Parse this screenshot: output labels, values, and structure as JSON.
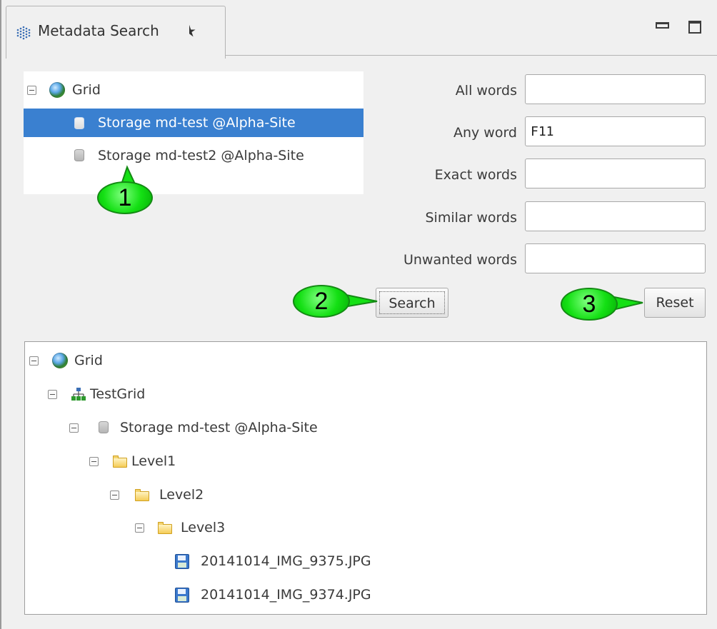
{
  "tab": {
    "title": "Metadata Search",
    "icon": "grid-dots-icon"
  },
  "storage_tree": {
    "root": {
      "label": "Grid",
      "icon": "globe-icon"
    },
    "items": [
      {
        "label": "Storage md-test @Alpha-Site",
        "icon": "database-icon",
        "selected": true
      },
      {
        "label": "Storage md-test2 @Alpha-Site",
        "icon": "database-icon",
        "selected": false
      }
    ]
  },
  "form": {
    "fields": [
      {
        "label": "All words",
        "value": ""
      },
      {
        "label": "Any word",
        "value": "F11"
      },
      {
        "label": "Exact words",
        "value": ""
      },
      {
        "label": "Similar words",
        "value": ""
      },
      {
        "label": "Unwanted words",
        "value": ""
      }
    ],
    "search_label": "Search",
    "reset_label": "Reset"
  },
  "callouts": [
    "1",
    "2",
    "3"
  ],
  "results_tree": {
    "nodes": [
      {
        "label": "Grid",
        "icon": "globe-icon",
        "depth": 0
      },
      {
        "label": "TestGrid",
        "icon": "network-icon",
        "depth": 1
      },
      {
        "label": "Storage md-test @Alpha-Site",
        "icon": "database-icon",
        "depth": 2
      },
      {
        "label": "Level1",
        "icon": "folder-icon",
        "depth": 3
      },
      {
        "label": "Level2",
        "icon": "folder-icon",
        "depth": 4
      },
      {
        "label": "Level3",
        "icon": "folder-icon",
        "depth": 5
      },
      {
        "label": "20141014_IMG_9375.JPG",
        "icon": "file-icon",
        "depth": 6
      },
      {
        "label": "20141014_IMG_9374.JPG",
        "icon": "file-icon",
        "depth": 6
      }
    ]
  },
  "colors": {
    "selection": "#3a80d0",
    "callout": "#14e014"
  }
}
